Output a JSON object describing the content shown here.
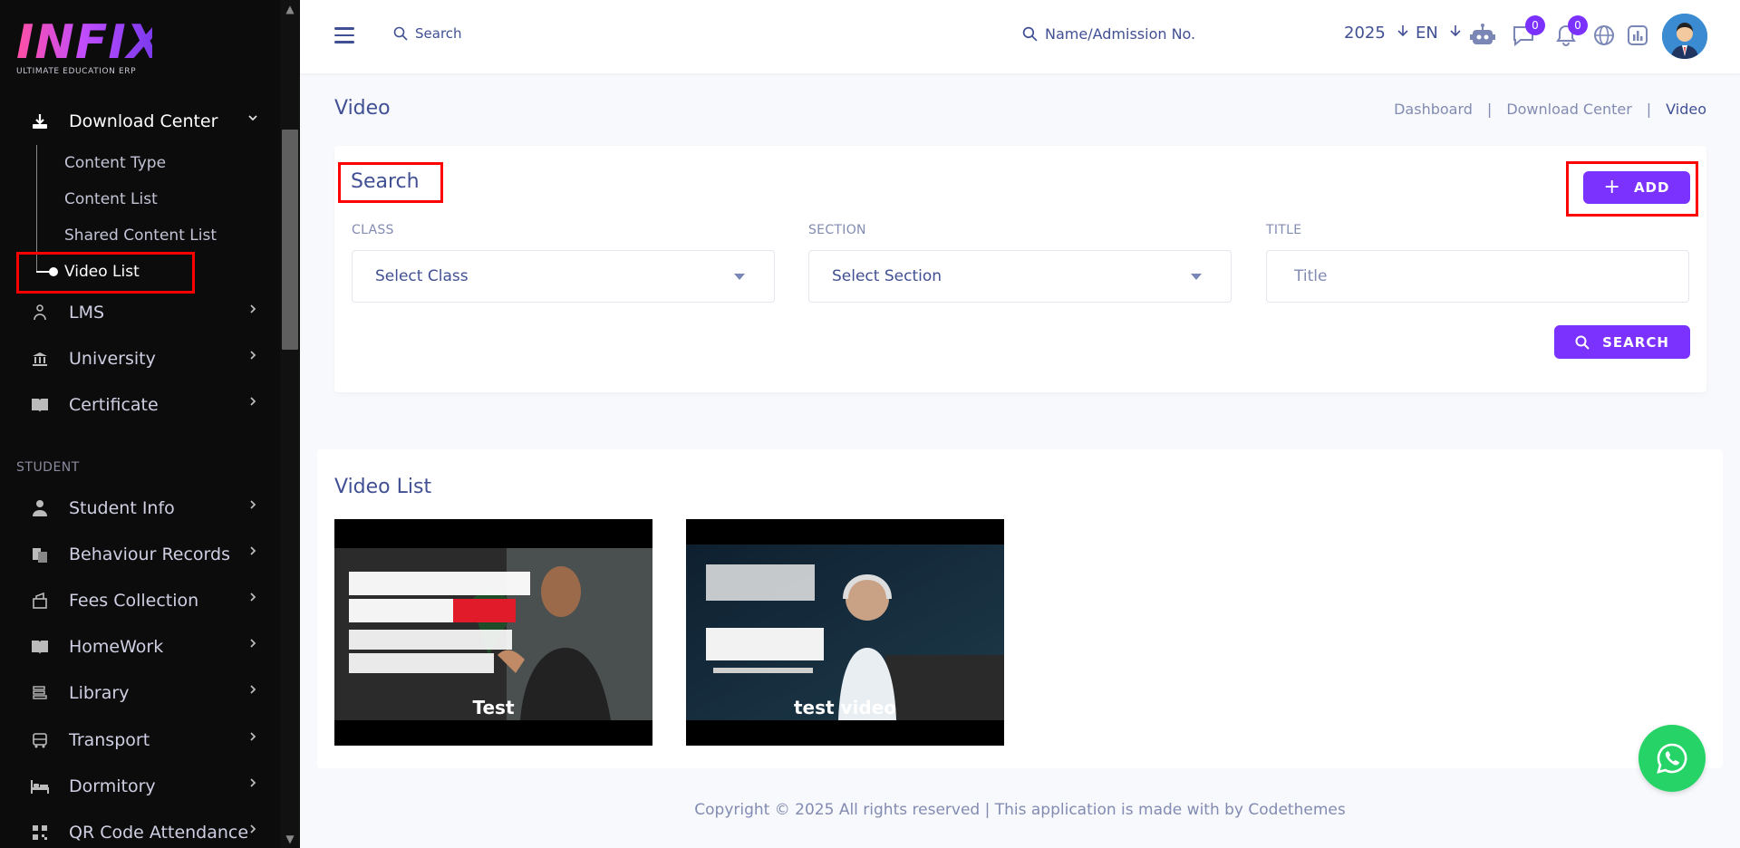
{
  "brand": {
    "logo_text": "INFIX",
    "tagline": "ULTIMATE EDUCATION ERP",
    "accent": "#7c32ff"
  },
  "sidebar": {
    "active_group": {
      "label": "Download Center",
      "icon": "download-icon"
    },
    "sub_items": [
      {
        "label": "Content Type"
      },
      {
        "label": "Content List"
      },
      {
        "label": "Shared Content List"
      },
      {
        "label": "Video List",
        "active": true
      }
    ],
    "items": [
      {
        "label": "LMS",
        "icon": "lms-icon"
      },
      {
        "label": "University",
        "icon": "university-icon"
      },
      {
        "label": "Certificate",
        "icon": "certificate-icon"
      }
    ],
    "section_student": "STUDENT",
    "student_items": [
      {
        "label": "Student Info",
        "icon": "student-icon"
      },
      {
        "label": "Behaviour Records",
        "icon": "behaviour-icon"
      },
      {
        "label": "Fees Collection",
        "icon": "fees-icon"
      },
      {
        "label": "HomeWork",
        "icon": "homework-icon"
      },
      {
        "label": "Library",
        "icon": "library-icon"
      },
      {
        "label": "Transport",
        "icon": "transport-icon"
      },
      {
        "label": "Dormitory",
        "icon": "dormitory-icon"
      },
      {
        "label": "QR Code Attendance",
        "icon": "qr-icon"
      }
    ]
  },
  "header": {
    "search_label": "Search",
    "student_search_label": "Name/Admission No.",
    "year": "2025",
    "language": "EN",
    "messages_count": "0",
    "notifications_count": "0"
  },
  "page": {
    "title": "Video",
    "breadcrumb": [
      "Dashboard",
      "Download Center",
      "Video"
    ]
  },
  "search_card": {
    "title": "Search",
    "add_label": "ADD",
    "class_label": "CLASS",
    "class_value": "Select Class",
    "section_label": "SECTION",
    "section_value": "Select Section",
    "title_label": "TITLE",
    "title_placeholder": "Title",
    "search_button": "SEARCH"
  },
  "video_list": {
    "title": "Video List",
    "videos": [
      {
        "label": "Test"
      },
      {
        "label": "test video"
      }
    ]
  },
  "footer": {
    "text": "Copyright © 2025 All rights reserved | This application is made with by Codethemes"
  }
}
